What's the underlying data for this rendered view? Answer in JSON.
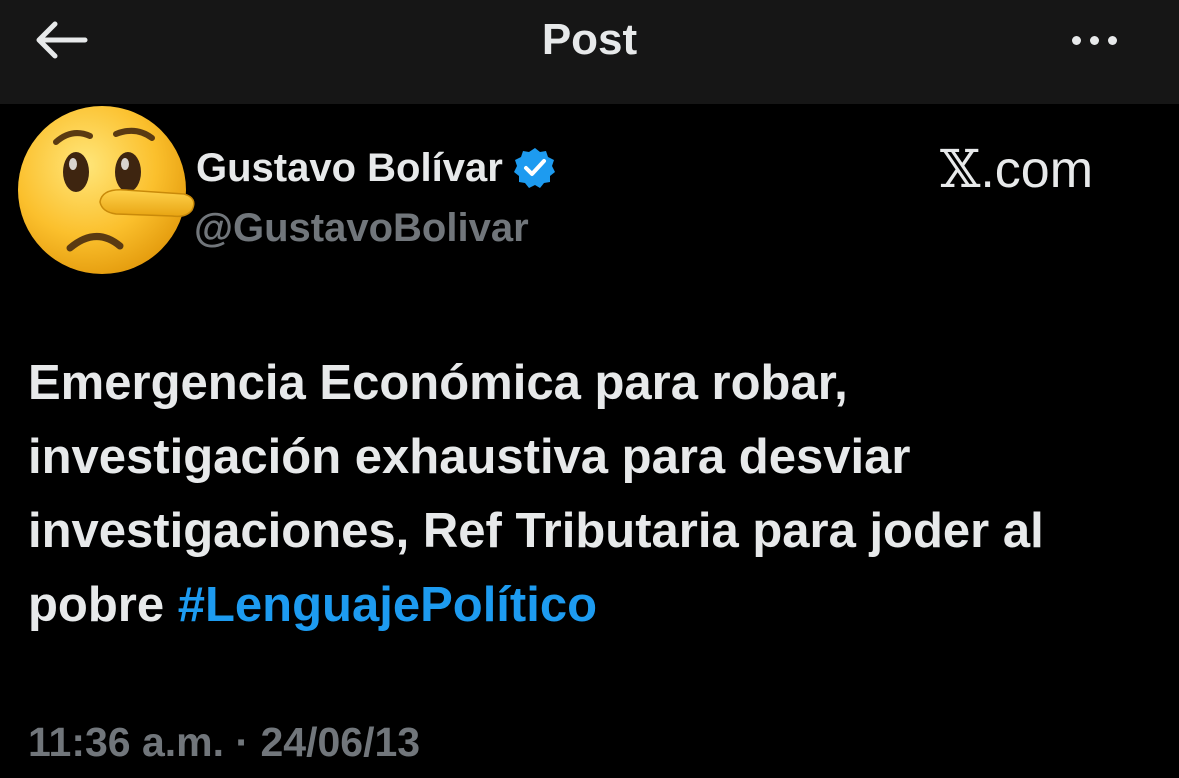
{
  "header": {
    "title": "Post",
    "back_icon": "arrow-left-icon",
    "more_icon": "more-horizontal-icon"
  },
  "author": {
    "display_name": "Gustavo Bolívar",
    "handle": "@GustavoBolivar",
    "verified": true,
    "avatar_icon": "lying-face-emoji"
  },
  "watermark": {
    "text": ".com",
    "logo": "𝕏"
  },
  "post": {
    "text_before_hashtag": "Emergencia Económica para robar, investigación exhaustiva para desviar investigaciones, Ref Tributaria para joder al pobre ",
    "hashtag": "#LenguajePolítico",
    "timestamp": "11:36 a.m. · 24/06/13"
  },
  "colors": {
    "background": "#000000",
    "header_background": "#161616",
    "text_primary": "#e7e9ea",
    "text_secondary": "#71767b",
    "accent": "#1d9bf0"
  }
}
